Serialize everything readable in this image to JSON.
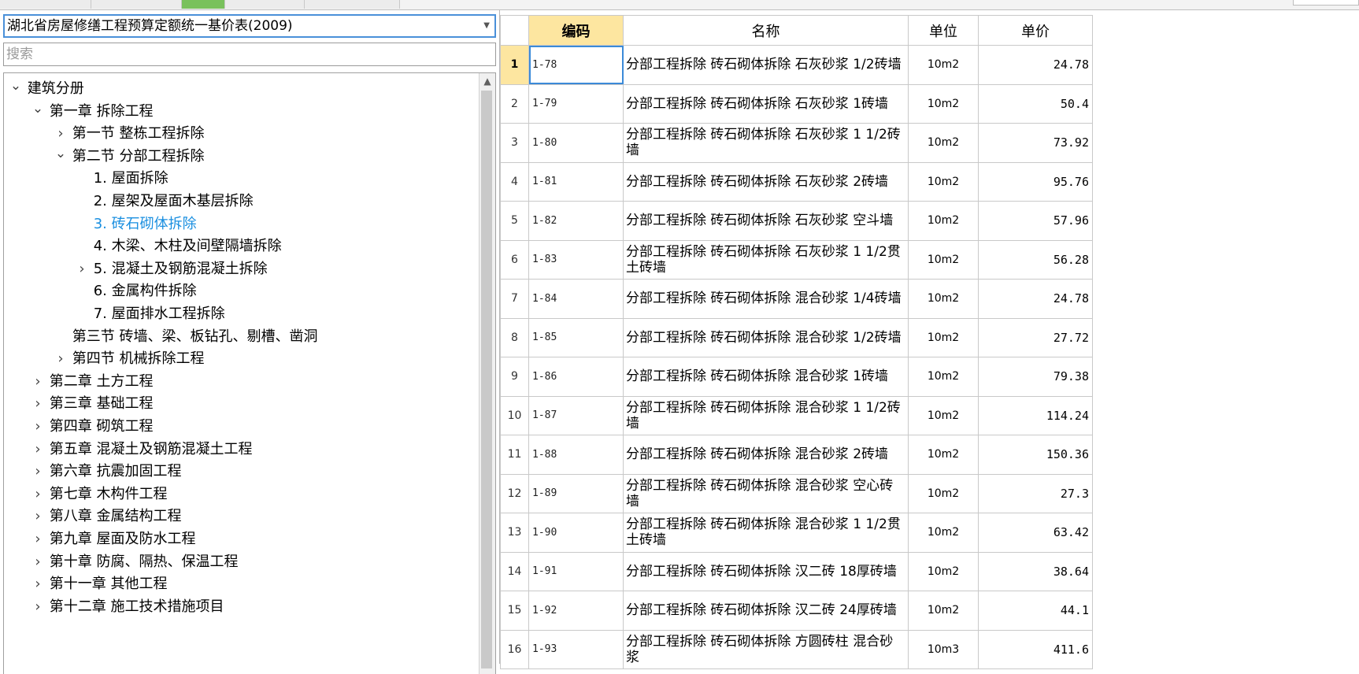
{
  "left_pane": {
    "library_select": "湖北省房屋修缮工程预算定额统一基价表(2009)",
    "search_placeholder": "搜索",
    "tree": [
      {
        "label": "建筑分册",
        "level": 0,
        "toggle": "expanded"
      },
      {
        "label": "第一章 拆除工程",
        "level": 1,
        "toggle": "expanded"
      },
      {
        "label": "第一节 整栋工程拆除",
        "level": 2,
        "toggle": "collapsed"
      },
      {
        "label": "第二节 分部工程拆除",
        "level": 2,
        "toggle": "expanded"
      },
      {
        "label": "1. 屋面拆除",
        "level": 3,
        "toggle": "none"
      },
      {
        "label": "2. 屋架及屋面木基层拆除",
        "level": 3,
        "toggle": "none"
      },
      {
        "label": "3. 砖石砌体拆除",
        "level": 3,
        "toggle": "none",
        "selected": true
      },
      {
        "label": "4. 木梁、木柱及间壁隔墙拆除",
        "level": 3,
        "toggle": "none"
      },
      {
        "label": "5. 混凝土及钢筋混凝土拆除",
        "level": 3,
        "toggle": "collapsed"
      },
      {
        "label": "6. 金属构件拆除",
        "level": 3,
        "toggle": "none"
      },
      {
        "label": "7. 屋面排水工程拆除",
        "level": 3,
        "toggle": "none"
      },
      {
        "label": "第三节 砖墙、梁、板钻孔、剔槽、凿洞",
        "level": 2,
        "toggle": "none"
      },
      {
        "label": "第四节 机械拆除工程",
        "level": 2,
        "toggle": "collapsed"
      },
      {
        "label": "第二章 土方工程",
        "level": 1,
        "toggle": "collapsed"
      },
      {
        "label": "第三章 基础工程",
        "level": 1,
        "toggle": "collapsed"
      },
      {
        "label": "第四章 砌筑工程",
        "level": 1,
        "toggle": "collapsed"
      },
      {
        "label": "第五章 混凝土及钢筋混凝土工程",
        "level": 1,
        "toggle": "collapsed"
      },
      {
        "label": "第六章 抗震加固工程",
        "level": 1,
        "toggle": "collapsed"
      },
      {
        "label": "第七章 木构件工程",
        "level": 1,
        "toggle": "collapsed"
      },
      {
        "label": "第八章 金属结构工程",
        "level": 1,
        "toggle": "collapsed"
      },
      {
        "label": "第九章 屋面及防水工程",
        "level": 1,
        "toggle": "collapsed"
      },
      {
        "label": "第十章 防腐、隔热、保温工程",
        "level": 1,
        "toggle": "collapsed"
      },
      {
        "label": "第十一章 其他工程",
        "level": 1,
        "toggle": "collapsed"
      },
      {
        "label": "第十二章 施工技术措施项目",
        "level": 1,
        "toggle": "collapsed"
      }
    ]
  },
  "table": {
    "headers": {
      "code": "编码",
      "name": "名称",
      "unit": "单位",
      "price": "单价"
    },
    "rows": [
      {
        "no": "1",
        "code": "1-78",
        "name": "分部工程拆除 砖石砌体拆除 石灰砂浆 1/2砖墙",
        "unit": "10m2",
        "price": "24.78",
        "current": true
      },
      {
        "no": "2",
        "code": "1-79",
        "name": "分部工程拆除 砖石砌体拆除 石灰砂浆 1砖墙",
        "unit": "10m2",
        "price": "50.4"
      },
      {
        "no": "3",
        "code": "1-80",
        "name": "分部工程拆除 砖石砌体拆除 石灰砂浆 1 1/2砖墙",
        "unit": "10m2",
        "price": "73.92"
      },
      {
        "no": "4",
        "code": "1-81",
        "name": "分部工程拆除 砖石砌体拆除 石灰砂浆 2砖墙",
        "unit": "10m2",
        "price": "95.76"
      },
      {
        "no": "5",
        "code": "1-82",
        "name": "分部工程拆除 砖石砌体拆除 石灰砂浆 空斗墙",
        "unit": "10m2",
        "price": "57.96"
      },
      {
        "no": "6",
        "code": "1-83",
        "name": "分部工程拆除 砖石砌体拆除 石灰砂浆 1 1/2贯土砖墙",
        "unit": "10m2",
        "price": "56.28"
      },
      {
        "no": "7",
        "code": "1-84",
        "name": "分部工程拆除 砖石砌体拆除 混合砂浆 1/4砖墙",
        "unit": "10m2",
        "price": "24.78"
      },
      {
        "no": "8",
        "code": "1-85",
        "name": "分部工程拆除 砖石砌体拆除 混合砂浆 1/2砖墙",
        "unit": "10m2",
        "price": "27.72"
      },
      {
        "no": "9",
        "code": "1-86",
        "name": "分部工程拆除 砖石砌体拆除 混合砂浆 1砖墙",
        "unit": "10m2",
        "price": "79.38"
      },
      {
        "no": "10",
        "code": "1-87",
        "name": "分部工程拆除 砖石砌体拆除 混合砂浆 1 1/2砖墙",
        "unit": "10m2",
        "price": "114.24"
      },
      {
        "no": "11",
        "code": "1-88",
        "name": "分部工程拆除 砖石砌体拆除 混合砂浆 2砖墙",
        "unit": "10m2",
        "price": "150.36"
      },
      {
        "no": "12",
        "code": "1-89",
        "name": "分部工程拆除 砖石砌体拆除 混合砂浆 空心砖墙",
        "unit": "10m2",
        "price": "27.3"
      },
      {
        "no": "13",
        "code": "1-90",
        "name": "分部工程拆除 砖石砌体拆除 混合砂浆 1 1/2贯土砖墙",
        "unit": "10m2",
        "price": "63.42"
      },
      {
        "no": "14",
        "code": "1-91",
        "name": "分部工程拆除 砖石砌体拆除 汉二砖 18厚砖墙",
        "unit": "10m2",
        "price": "38.64"
      },
      {
        "no": "15",
        "code": "1-92",
        "name": "分部工程拆除 砖石砌体拆除 汉二砖 24厚砖墙",
        "unit": "10m2",
        "price": "44.1"
      },
      {
        "no": "16",
        "code": "1-93",
        "name": "分部工程拆除 砖石砌体拆除 方圆砖柱 混合砂浆",
        "unit": "10m3",
        "price": "411.6"
      }
    ]
  },
  "colors": {
    "accent_tab": "#79c15c",
    "selected_text": "#1a8fe0",
    "header_highlight": "#fde6a0",
    "focus_border": "#3b8ad8"
  }
}
